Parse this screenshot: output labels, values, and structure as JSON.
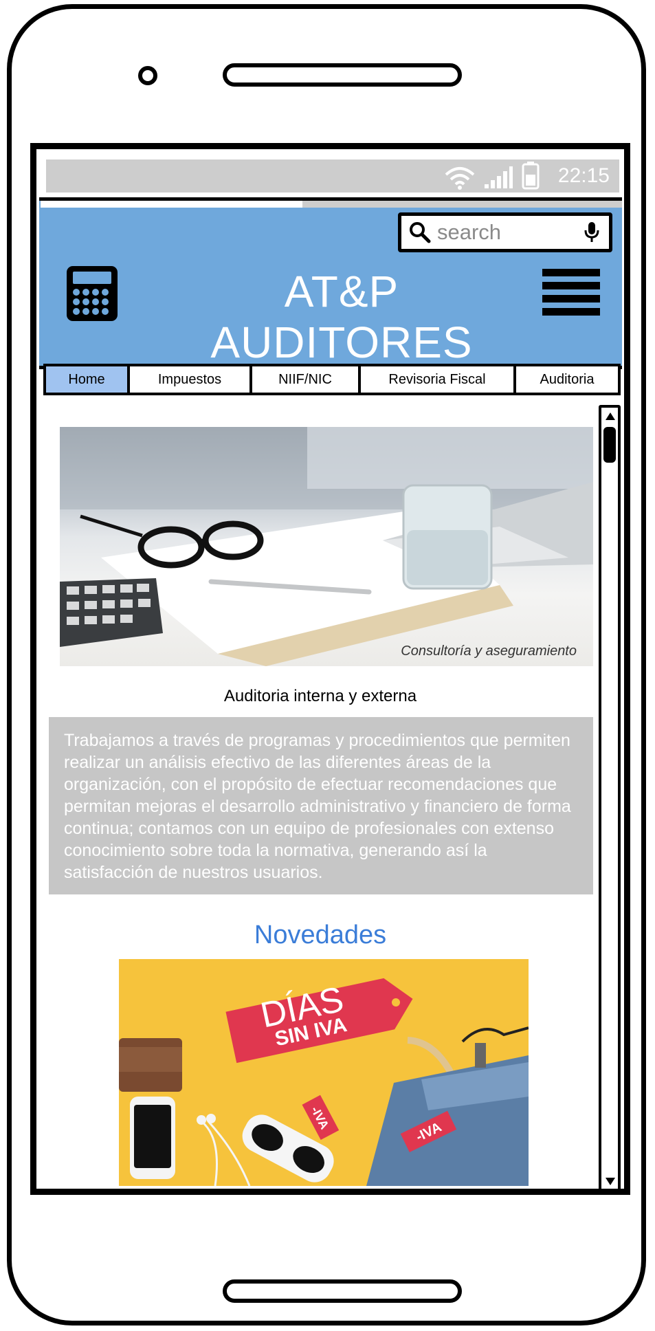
{
  "status_bar": {
    "time": "22:15"
  },
  "search": {
    "placeholder": "search"
  },
  "header": {
    "title": "AT&P AUDITORES"
  },
  "progress": {
    "fraction": 0.45
  },
  "nav": {
    "tabs": [
      "Home",
      "Impuestos",
      "NIIF/NIC",
      "Revisoria Fiscal",
      "Auditoria"
    ],
    "active": "Home"
  },
  "hero": {
    "caption": "Consultoría y aseguramiento"
  },
  "section": {
    "title": "Auditoria interna y externa",
    "body": "Trabajamos a través de programas y procedimientos que permiten realizar un análisis efectivo de las diferentes áreas de la organización, con el propósito de efectuar recomendaciones que permitan mejoras el desarrollo administrativo y financiero de forma continua; contamos con un equipo de profesionales con extenso conocimiento sobre toda la normativa, generando así la satisfacción de nuestros usuarios."
  },
  "news": {
    "heading": "Novedades",
    "promo_tag_line1": "DÍAS",
    "promo_tag_line2": "SIN IVA",
    "small_tag_1": "-IVA",
    "small_tag_2": "-IVA"
  },
  "colors": {
    "header_bg": "#6fa8dc",
    "active_tab": "#a0c3f0",
    "accent_heading": "#3b7dd8",
    "description_bg": "#c6c6c6",
    "status_bar_bg": "#cdcdcd"
  },
  "icons": [
    "wifi-icon",
    "signal-icon",
    "battery-icon",
    "search-icon",
    "microphone-icon",
    "calculator-icon",
    "hamburger-menu-icon",
    "scroll-up-icon",
    "scroll-down-icon"
  ]
}
